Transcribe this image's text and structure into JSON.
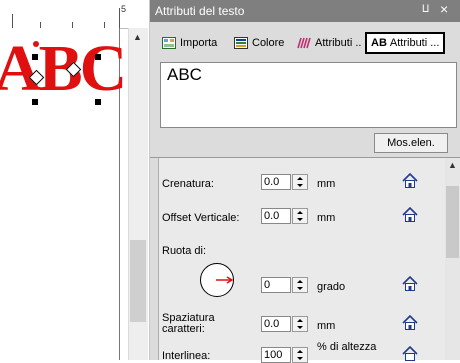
{
  "ruler": {
    "mark_label": "5"
  },
  "canvas": {
    "text": "ABC",
    "text_color": "#e01010"
  },
  "panel": {
    "title": "Attributi del testo",
    "pin_glyph": "⨿",
    "close_glyph": "×",
    "tabs": [
      {
        "label": "Importa",
        "icon": "import-icon"
      },
      {
        "label": "Colore",
        "icon": "color-icon"
      },
      {
        "label": "Attributi ..",
        "icon": "attributes-icon"
      },
      {
        "label": "Attributi ...",
        "icon": "ab-text-attributes-icon",
        "active": true
      }
    ],
    "text_value": "ABC",
    "show_elements_button": "Mos.elen."
  },
  "properties": {
    "kerning": {
      "label": "Crenatura:",
      "value": "0.0",
      "unit": "mm"
    },
    "vertical_offset": {
      "label": "Offset Verticale:",
      "value": "0.0",
      "unit": "mm"
    },
    "rotate": {
      "label": "Ruota di:",
      "value": "0",
      "unit": "grado"
    },
    "char_spacing": {
      "label_line1": "Spaziatura",
      "label_line2": "caratteri:",
      "value": "0.0",
      "unit": "mm"
    },
    "line_spacing": {
      "label": "Interlinea:",
      "value": "100",
      "unit_line1": "% di altezza",
      "unit_line2": ""
    }
  },
  "colors": {
    "accent_red": "#e01010",
    "title_bar": "#7f7f7f",
    "home_icon": "#1f3a8a"
  }
}
